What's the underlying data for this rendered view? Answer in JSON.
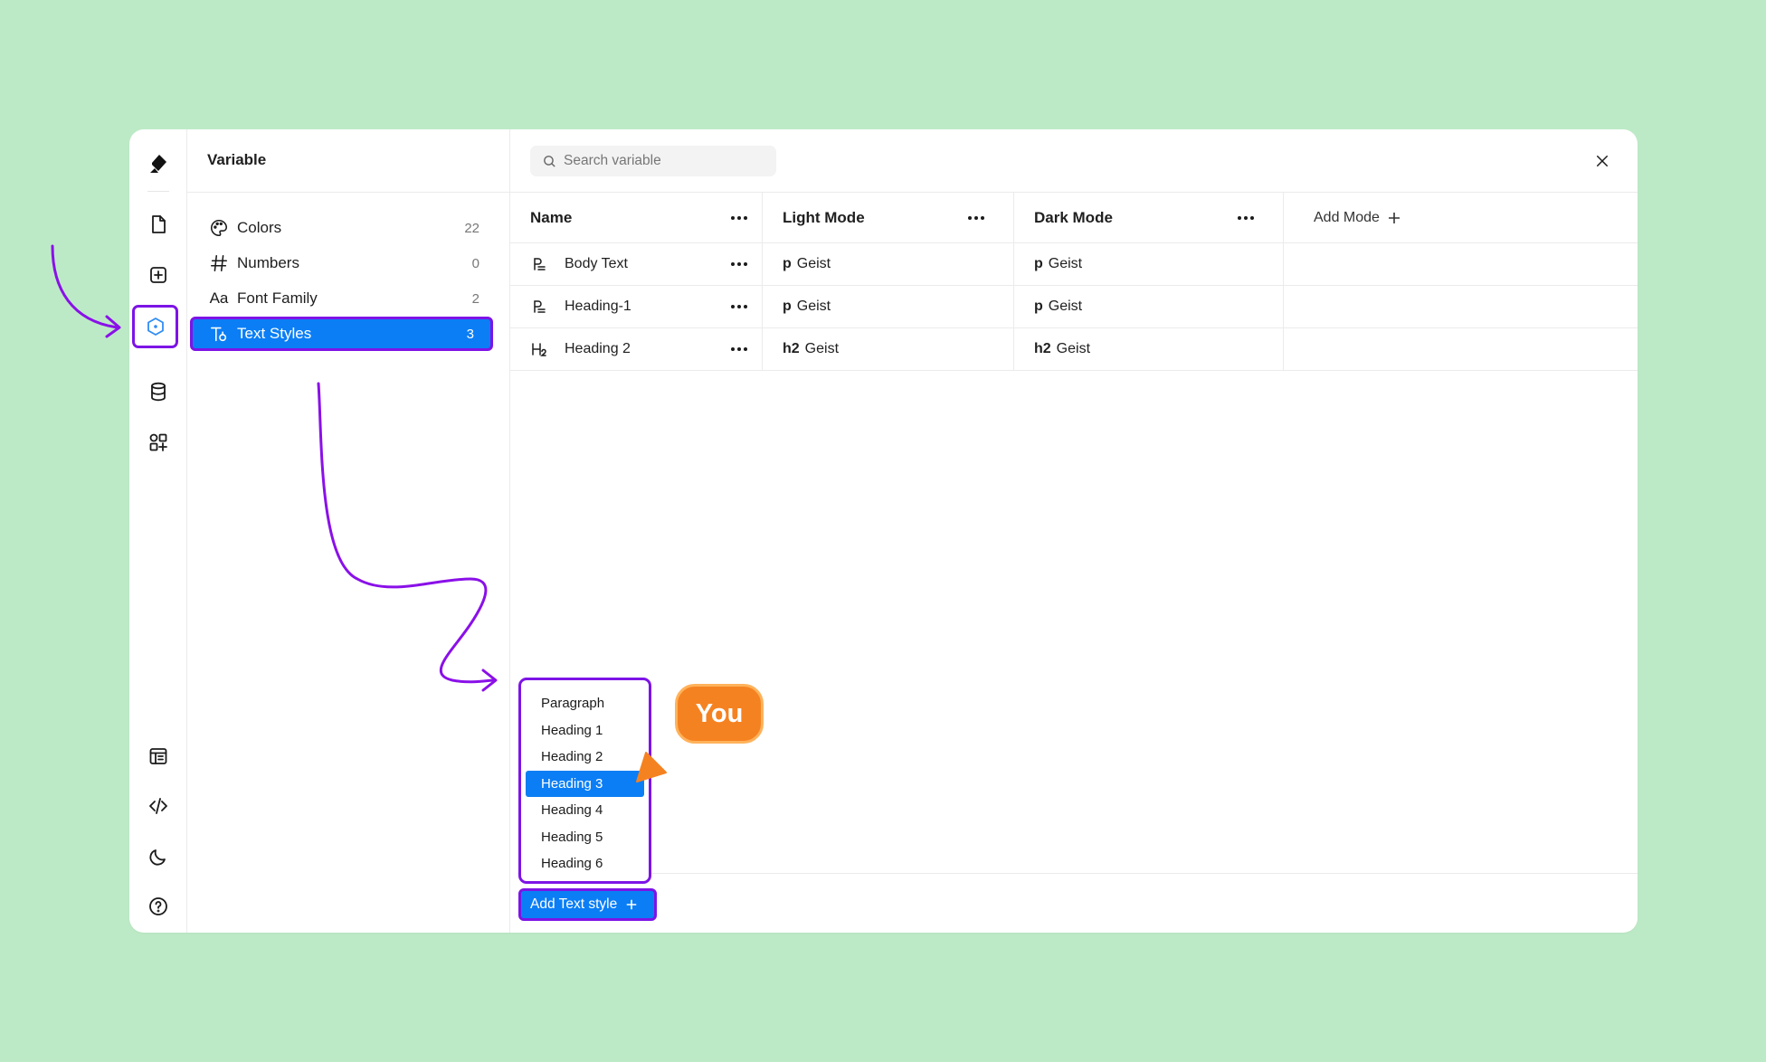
{
  "sidebar": {
    "title": "Variable",
    "items": [
      {
        "label": "Colors",
        "count": "22"
      },
      {
        "label": "Numbers",
        "count": "0"
      },
      {
        "label": "Font Family",
        "count": "2"
      },
      {
        "label": "Text Styles",
        "count": "3"
      }
    ],
    "font_icon_text": "Aa"
  },
  "search": {
    "placeholder": "Search variable"
  },
  "table": {
    "headers": {
      "name": "Name",
      "light": "Light Mode",
      "dark": "Dark Mode",
      "add_mode": "Add Mode"
    },
    "rows": [
      {
        "name": "Body Text",
        "light_tag": "p",
        "light_value": "Geist",
        "dark_tag": "p",
        "dark_value": "Geist"
      },
      {
        "name": "Heading-1",
        "light_tag": "p",
        "light_value": "Geist",
        "dark_tag": "p",
        "dark_value": "Geist"
      },
      {
        "name": "Heading 2",
        "light_tag": "h2",
        "light_value": "Geist",
        "dark_tag": "h2",
        "dark_value": "Geist"
      }
    ]
  },
  "dropdown": {
    "items": [
      "Paragraph",
      "Heading 1",
      "Heading 2",
      "Heading 3",
      "Heading 4",
      "Heading 5",
      "Heading 6"
    ],
    "selected": "Heading 3"
  },
  "add_text_style": {
    "label": "Add Text style"
  },
  "cursor_badge": {
    "label": "You"
  },
  "colors": {
    "accent_blue": "#0b7ef5",
    "highlight_purple": "#7d14e6",
    "cursor_orange": "#f58220",
    "background_green": "#bdeac6"
  },
  "icons": {
    "rail": [
      "logo-icon",
      "page-icon",
      "add-square-icon",
      "variable-hexagon-icon",
      "database-icon",
      "components-icon",
      "table-layout-icon",
      "code-icon",
      "moon-icon",
      "help-icon"
    ]
  }
}
